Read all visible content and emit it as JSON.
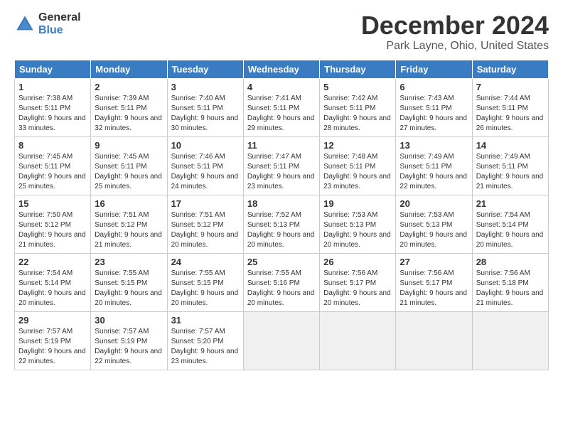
{
  "logo": {
    "general": "General",
    "blue": "Blue"
  },
  "title": "December 2024",
  "subtitle": "Park Layne, Ohio, United States",
  "weekdays": [
    "Sunday",
    "Monday",
    "Tuesday",
    "Wednesday",
    "Thursday",
    "Friday",
    "Saturday"
  ],
  "weeks": [
    [
      {
        "num": "1",
        "info": "Sunrise: 7:38 AM\nSunset: 5:11 PM\nDaylight: 9 hours\nand 33 minutes."
      },
      {
        "num": "2",
        "info": "Sunrise: 7:39 AM\nSunset: 5:11 PM\nDaylight: 9 hours\nand 32 minutes."
      },
      {
        "num": "3",
        "info": "Sunrise: 7:40 AM\nSunset: 5:11 PM\nDaylight: 9 hours\nand 30 minutes."
      },
      {
        "num": "4",
        "info": "Sunrise: 7:41 AM\nSunset: 5:11 PM\nDaylight: 9 hours\nand 29 minutes."
      },
      {
        "num": "5",
        "info": "Sunrise: 7:42 AM\nSunset: 5:11 PM\nDaylight: 9 hours\nand 28 minutes."
      },
      {
        "num": "6",
        "info": "Sunrise: 7:43 AM\nSunset: 5:11 PM\nDaylight: 9 hours\nand 27 minutes."
      },
      {
        "num": "7",
        "info": "Sunrise: 7:44 AM\nSunset: 5:11 PM\nDaylight: 9 hours\nand 26 minutes."
      }
    ],
    [
      {
        "num": "8",
        "info": "Sunrise: 7:45 AM\nSunset: 5:11 PM\nDaylight: 9 hours\nand 25 minutes."
      },
      {
        "num": "9",
        "info": "Sunrise: 7:45 AM\nSunset: 5:11 PM\nDaylight: 9 hours\nand 25 minutes."
      },
      {
        "num": "10",
        "info": "Sunrise: 7:46 AM\nSunset: 5:11 PM\nDaylight: 9 hours\nand 24 minutes."
      },
      {
        "num": "11",
        "info": "Sunrise: 7:47 AM\nSunset: 5:11 PM\nDaylight: 9 hours\nand 23 minutes."
      },
      {
        "num": "12",
        "info": "Sunrise: 7:48 AM\nSunset: 5:11 PM\nDaylight: 9 hours\nand 23 minutes."
      },
      {
        "num": "13",
        "info": "Sunrise: 7:49 AM\nSunset: 5:11 PM\nDaylight: 9 hours\nand 22 minutes."
      },
      {
        "num": "14",
        "info": "Sunrise: 7:49 AM\nSunset: 5:11 PM\nDaylight: 9 hours\nand 21 minutes."
      }
    ],
    [
      {
        "num": "15",
        "info": "Sunrise: 7:50 AM\nSunset: 5:12 PM\nDaylight: 9 hours\nand 21 minutes."
      },
      {
        "num": "16",
        "info": "Sunrise: 7:51 AM\nSunset: 5:12 PM\nDaylight: 9 hours\nand 21 minutes."
      },
      {
        "num": "17",
        "info": "Sunrise: 7:51 AM\nSunset: 5:12 PM\nDaylight: 9 hours\nand 20 minutes."
      },
      {
        "num": "18",
        "info": "Sunrise: 7:52 AM\nSunset: 5:13 PM\nDaylight: 9 hours\nand 20 minutes."
      },
      {
        "num": "19",
        "info": "Sunrise: 7:53 AM\nSunset: 5:13 PM\nDaylight: 9 hours\nand 20 minutes."
      },
      {
        "num": "20",
        "info": "Sunrise: 7:53 AM\nSunset: 5:13 PM\nDaylight: 9 hours\nand 20 minutes."
      },
      {
        "num": "21",
        "info": "Sunrise: 7:54 AM\nSunset: 5:14 PM\nDaylight: 9 hours\nand 20 minutes."
      }
    ],
    [
      {
        "num": "22",
        "info": "Sunrise: 7:54 AM\nSunset: 5:14 PM\nDaylight: 9 hours\nand 20 minutes."
      },
      {
        "num": "23",
        "info": "Sunrise: 7:55 AM\nSunset: 5:15 PM\nDaylight: 9 hours\nand 20 minutes."
      },
      {
        "num": "24",
        "info": "Sunrise: 7:55 AM\nSunset: 5:15 PM\nDaylight: 9 hours\nand 20 minutes."
      },
      {
        "num": "25",
        "info": "Sunrise: 7:55 AM\nSunset: 5:16 PM\nDaylight: 9 hours\nand 20 minutes."
      },
      {
        "num": "26",
        "info": "Sunrise: 7:56 AM\nSunset: 5:17 PM\nDaylight: 9 hours\nand 20 minutes."
      },
      {
        "num": "27",
        "info": "Sunrise: 7:56 AM\nSunset: 5:17 PM\nDaylight: 9 hours\nand 21 minutes."
      },
      {
        "num": "28",
        "info": "Sunrise: 7:56 AM\nSunset: 5:18 PM\nDaylight: 9 hours\nand 21 minutes."
      }
    ],
    [
      {
        "num": "29",
        "info": "Sunrise: 7:57 AM\nSunset: 5:19 PM\nDaylight: 9 hours\nand 22 minutes."
      },
      {
        "num": "30",
        "info": "Sunrise: 7:57 AM\nSunset: 5:19 PM\nDaylight: 9 hours\nand 22 minutes."
      },
      {
        "num": "31",
        "info": "Sunrise: 7:57 AM\nSunset: 5:20 PM\nDaylight: 9 hours\nand 23 minutes."
      },
      {
        "num": "",
        "info": ""
      },
      {
        "num": "",
        "info": ""
      },
      {
        "num": "",
        "info": ""
      },
      {
        "num": "",
        "info": ""
      }
    ]
  ]
}
